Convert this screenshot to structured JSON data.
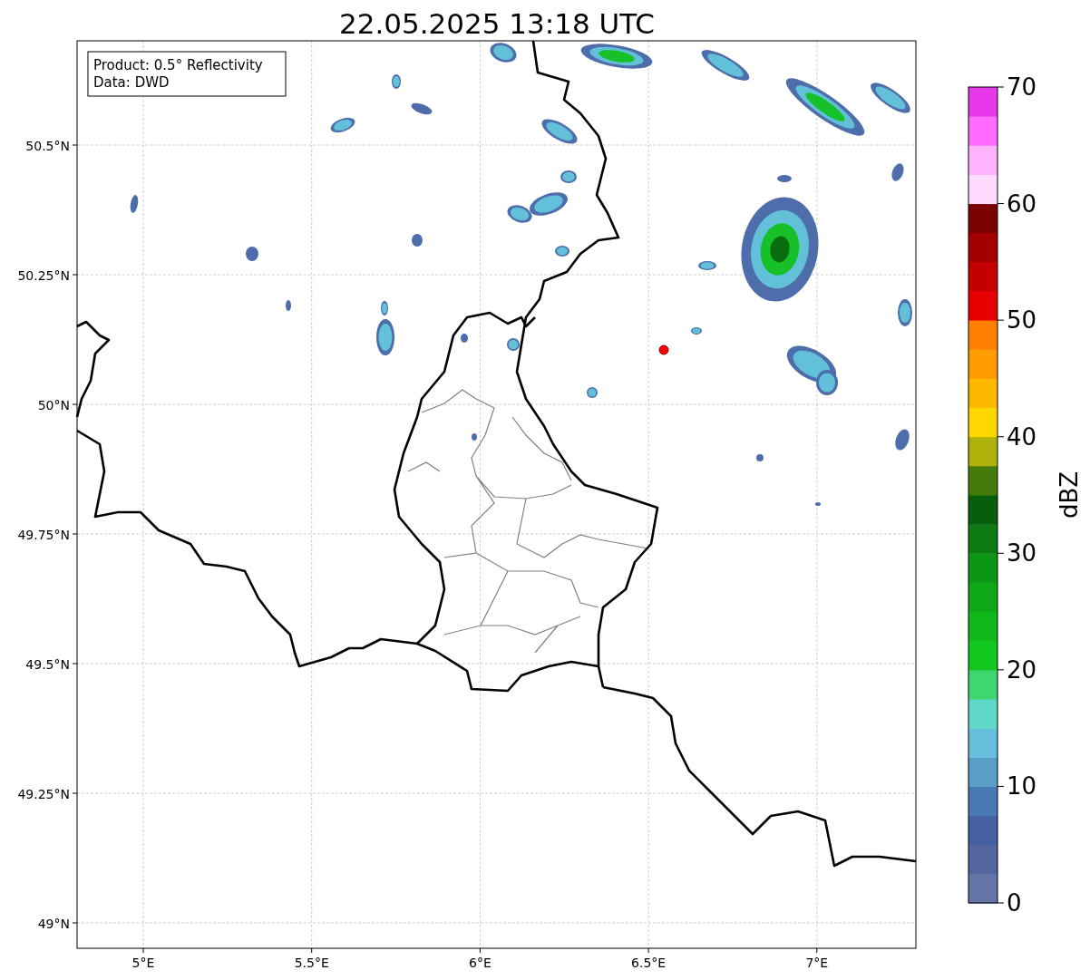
{
  "title": "22.05.2025 13:18 UTC",
  "info_box": {
    "lines": [
      "Product: 0.5° Reflectivity",
      "Data: DWD"
    ]
  },
  "map": {
    "latitude_labels": [
      "50.5°N",
      "50.25°N",
      "50°N",
      "49.75°N",
      "49.5°N",
      "49.25°N",
      "49°N"
    ],
    "longitude_labels": [
      "5°E",
      "5.5°E",
      "6°E",
      "6.5°E",
      "7°E"
    ]
  },
  "colorbar": {
    "label": "dBZ",
    "ticks": [
      "70",
      "60",
      "50",
      "40",
      "30",
      "20",
      "10",
      "0"
    ],
    "bins": [
      {
        "color": "#6474a6"
      },
      {
        "color": "#5466a0"
      },
      {
        "color": "#4560a3"
      },
      {
        "color": "#4a7ab3"
      },
      {
        "color": "#5a9ec8"
      },
      {
        "color": "#66c0dd"
      },
      {
        "color": "#62d8c8"
      },
      {
        "color": "#3ed670"
      },
      {
        "color": "#12c81e"
      },
      {
        "color": "#10b91a"
      },
      {
        "color": "#0ea816"
      },
      {
        "color": "#0c9614"
      },
      {
        "color": "#0b7a12"
      },
      {
        "color": "#095e0e"
      },
      {
        "color": "#437a0a"
      },
      {
        "color": "#afb20a"
      },
      {
        "color": "#ffd700"
      },
      {
        "color": "#ffb800"
      },
      {
        "color": "#ff9c00"
      },
      {
        "color": "#ff8000"
      },
      {
        "color": "#e60000"
      },
      {
        "color": "#c40000"
      },
      {
        "color": "#a40000"
      },
      {
        "color": "#7b0000"
      },
      {
        "color": "#ffdcff"
      },
      {
        "color": "#ffb4ff"
      },
      {
        "color": "#ff6cff"
      },
      {
        "color": "#e838ec"
      }
    ]
  }
}
